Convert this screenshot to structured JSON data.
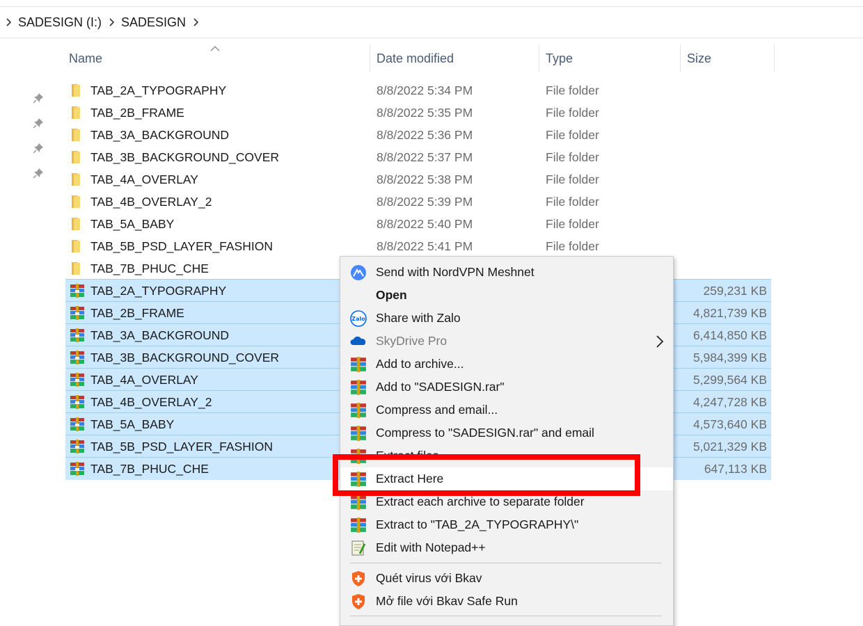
{
  "breadcrumb": [
    "SADESIGN (I:)",
    "SADESIGN"
  ],
  "columns": {
    "name": "Name",
    "date": "Date modified",
    "type": "Type",
    "size": "Size"
  },
  "folders": [
    {
      "name": "TAB_2A_TYPOGRAPHY",
      "date": "8/8/2022 5:34 PM",
      "type": "File folder"
    },
    {
      "name": "TAB_2B_FRAME",
      "date": "8/8/2022 5:35 PM",
      "type": "File folder"
    },
    {
      "name": "TAB_3A_BACKGROUND",
      "date": "8/8/2022 5:36 PM",
      "type": "File folder"
    },
    {
      "name": "TAB_3B_BACKGROUND_COVER",
      "date": "8/8/2022 5:37 PM",
      "type": "File folder"
    },
    {
      "name": "TAB_4A_OVERLAY",
      "date": "8/8/2022 5:38 PM",
      "type": "File folder"
    },
    {
      "name": "TAB_4B_OVERLAY_2",
      "date": "8/8/2022 5:39 PM",
      "type": "File folder"
    },
    {
      "name": "TAB_5A_BABY",
      "date": "8/8/2022 5:40 PM",
      "type": "File folder"
    },
    {
      "name": "TAB_5B_PSD_LAYER_FASHION",
      "date": "8/8/2022 5:41 PM",
      "type": "File folder"
    },
    {
      "name": "TAB_7B_PHUC_CHE",
      "date": "",
      "type": ""
    }
  ],
  "archives": [
    {
      "name": "TAB_2A_TYPOGRAPHY",
      "size": "259,231 KB"
    },
    {
      "name": "TAB_2B_FRAME",
      "size": "4,821,739 KB"
    },
    {
      "name": "TAB_3A_BACKGROUND",
      "size": "6,414,850 KB"
    },
    {
      "name": "TAB_3B_BACKGROUND_COVER",
      "size": "5,984,399 KB"
    },
    {
      "name": "TAB_4A_OVERLAY",
      "size": "5,299,564 KB"
    },
    {
      "name": "TAB_4B_OVERLAY_2",
      "size": "4,247,728 KB"
    },
    {
      "name": "TAB_5A_BABY",
      "size": "4,573,640 KB"
    },
    {
      "name": "TAB_5B_PSD_LAYER_FASHION",
      "size": "5,021,329 KB"
    },
    {
      "name": "TAB_7B_PHUC_CHE",
      "size": "647,113 KB"
    }
  ],
  "menu": {
    "items": [
      {
        "label": "Send with NordVPN Meshnet",
        "icon": "nordvpn-icon"
      },
      {
        "label": "Open",
        "icon": ""
      },
      {
        "label": "Share with Zalo",
        "icon": "zalo-icon"
      },
      {
        "label": "SkyDrive Pro",
        "icon": "skydrive-icon"
      },
      {
        "label": "Add to archive...",
        "icon": "winrar-icon"
      },
      {
        "label": "Add to \"SADESIGN.rar\"",
        "icon": "winrar-icon"
      },
      {
        "label": "Compress and email...",
        "icon": "winrar-icon"
      },
      {
        "label": "Compress to \"SADESIGN.rar\" and email",
        "icon": "winrar-icon"
      },
      {
        "label": "Extract files...",
        "icon": "winrar-icon"
      },
      {
        "label": "Extract Here",
        "icon": "winrar-icon"
      },
      {
        "label": "Extract each archive to separate folder",
        "icon": "winrar-icon"
      },
      {
        "label": "Extract to \"TAB_2A_TYPOGRAPHY\\\"",
        "icon": "winrar-icon"
      },
      {
        "label": "Edit with Notepad++",
        "icon": "notepadpp-icon"
      },
      {
        "label": "Quét virus với Bkav",
        "icon": "bkav-icon"
      },
      {
        "label": "Mở file với Bkav Safe Run",
        "icon": "bkav-icon"
      }
    ]
  },
  "colors": {
    "selection": "#cce8ff",
    "selection_border": "#99d1ff",
    "highlight_box": "#ff0000",
    "folder": "#f8d775"
  }
}
